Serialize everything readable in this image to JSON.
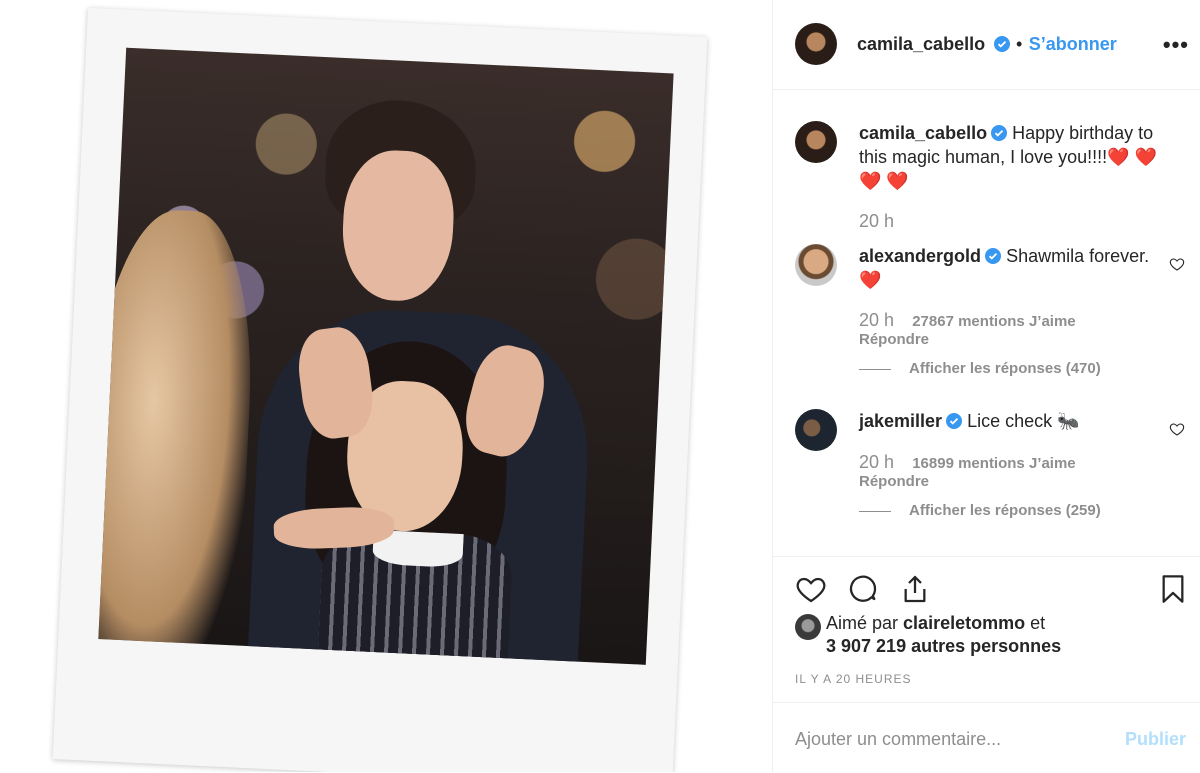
{
  "post": {
    "author": "camila_cabello",
    "follow_label": "S’abonner",
    "separator": "•",
    "more_label": "•••"
  },
  "caption": {
    "author": "camila_cabello",
    "text": "Happy birthday to this magic human, I love you!!!!❤️ ❤️ ❤️ ❤️",
    "time": "20 h"
  },
  "comments": [
    {
      "author": "alexandergold",
      "text": "Shawmila forever. ❤️",
      "time": "20 h",
      "likes": "27867 mentions J’aime",
      "reply_label": "Répondre",
      "view_replies": "Afficher les réponses (470)"
    },
    {
      "author": "jakemiller",
      "text": "Lice check 🐜",
      "time": "20 h",
      "likes": "16899 mentions J’aime",
      "reply_label": "Répondre",
      "view_replies": "Afficher les réponses (259)"
    }
  ],
  "liked_by": {
    "prefix": "Aimé par",
    "user": "claireletommo",
    "connector": "et",
    "others": "3 907 219 autres personnes"
  },
  "timestamp": "IL Y A 20 HEURES",
  "add_comment": {
    "placeholder": "Ajouter un commentaire...",
    "publish_label": "Publier"
  },
  "colors": {
    "accent": "#3897f0",
    "publish_disabled": "#b2dffc",
    "muted": "#8e8e8e",
    "text": "#262626"
  }
}
